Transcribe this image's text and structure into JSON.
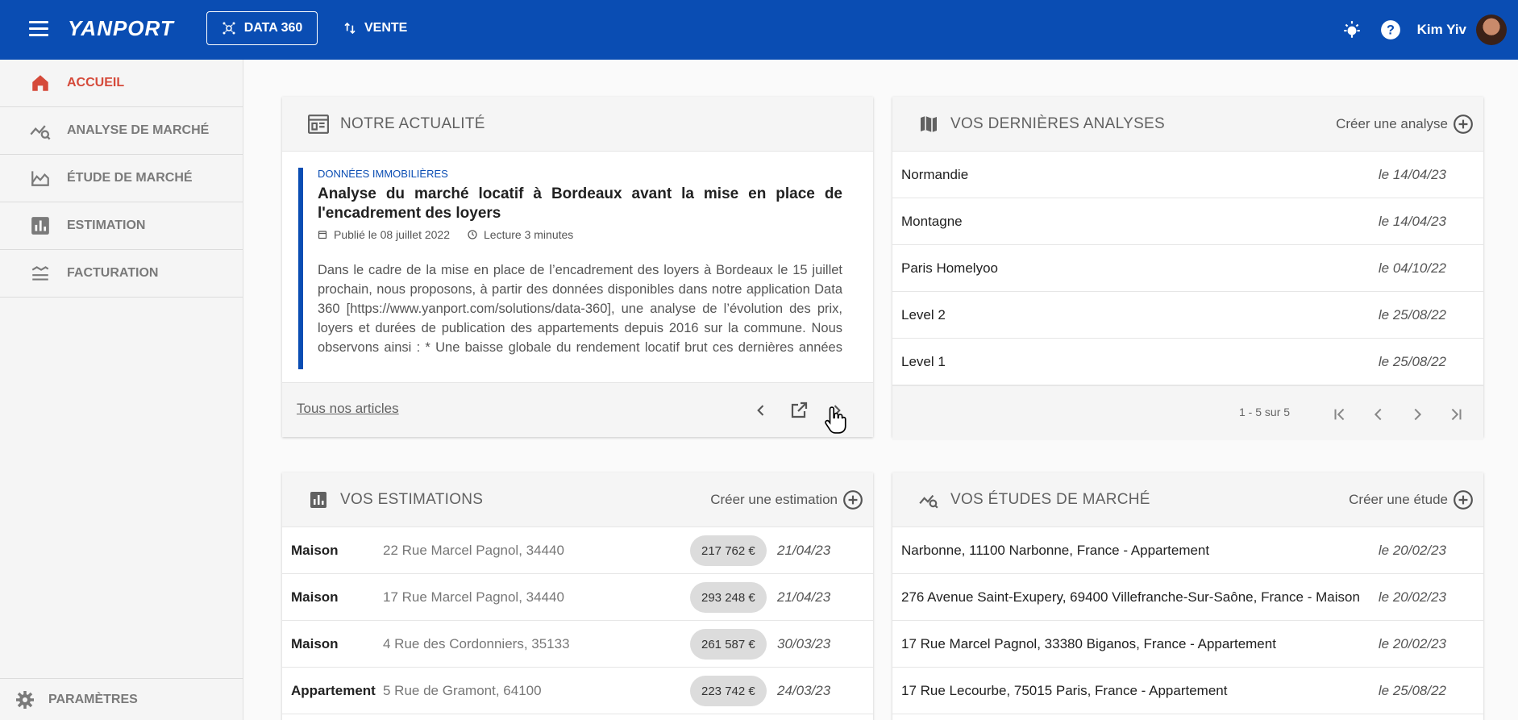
{
  "app": {
    "logo": "YANPORT",
    "data360_label": "DATA 360",
    "vente_label": "VENTE",
    "user_name": "Kim Yiv",
    "accent": "#0a4db3",
    "active_color": "#d54a3a"
  },
  "sidebar": {
    "items": [
      {
        "label": "ACCUEIL",
        "icon": "home-icon"
      },
      {
        "label": "ANALYSE DE MARCHÉ",
        "icon": "market-analysis-icon"
      },
      {
        "label": "ÉTUDE DE MARCHÉ",
        "icon": "market-study-icon"
      },
      {
        "label": "ESTIMATION",
        "icon": "bar-chart-icon"
      },
      {
        "label": "FACTURATION",
        "icon": "billing-icon"
      }
    ],
    "settings_label": "PARAMÈTRES"
  },
  "news": {
    "header": "NOTRE ACTUALITÉ",
    "category": "DONNÉES IMMOBILIÈRES",
    "title": "Analyse du marché locatif à Bordeaux avant la mise en place de l'encadrement des loyers",
    "published": "Publié le 08 juillet 2022",
    "reading": "Lecture 3 minutes",
    "text": "Dans le cadre de la mise en place de l’encadrement des loyers à Bordeaux le 15 juillet prochain, nous proposons, à partir des données disponibles dans notre application Data 360 [https://www.yanport.com/solutions/data-360], une analyse de l’évolution des prix, loyers et durées de publication des appartements depuis 2016 sur la commune. Nous observons ainsi : * Une baisse globale du rendement locatif brut ces dernières années due à une augmentation des prix plus rapide que celle des loyers",
    "all_link": "Tous nos articles"
  },
  "analyses": {
    "header": "VOS DERNIÈRES ANALYSES",
    "action": "Créer une analyse",
    "rows": [
      {
        "name": "Normandie",
        "date": "le 14/04/23"
      },
      {
        "name": "Montagne",
        "date": "le 14/04/23"
      },
      {
        "name": "Paris Homelyoo",
        "date": "le 04/10/22"
      },
      {
        "name": "Level 2",
        "date": "le 25/08/22"
      },
      {
        "name": "Level 1",
        "date": "le 25/08/22"
      }
    ],
    "pager_text": "1 - 5 sur 5"
  },
  "estimations": {
    "header": "VOS ESTIMATIONS",
    "action": "Créer une estimation",
    "rows": [
      {
        "type": "Maison",
        "address": "22 Rue Marcel Pagnol, 34440",
        "price": "217 762 €",
        "date": "21/04/23"
      },
      {
        "type": "Maison",
        "address": "17 Rue Marcel Pagnol, 34440",
        "price": "293 248 €",
        "date": "21/04/23"
      },
      {
        "type": "Maison",
        "address": "4 Rue des Cordonniers, 35133",
        "price": "261 587 €",
        "date": "30/03/23"
      },
      {
        "type": "Appartement",
        "address": "5 Rue de Gramont, 64100",
        "price": "223 742 €",
        "date": "24/03/23"
      }
    ]
  },
  "studies": {
    "header": "VOS ÉTUDES DE MARCHÉ",
    "action": "Créer une étude",
    "rows": [
      {
        "name": "Narbonne, 11100 Narbonne, France - Appartement",
        "date": "le 20/02/23"
      },
      {
        "name": "276 Avenue Saint-Exupery, 69400 Villefranche-Sur-Saône, France - Maison",
        "date": "le 20/02/23"
      },
      {
        "name": "17 Rue Marcel Pagnol, 33380 Biganos, France - Appartement",
        "date": "le 20/02/23"
      },
      {
        "name": "17 Rue Lecourbe, 75015 Paris, France - Appartement",
        "date": "le 25/08/22"
      }
    ]
  }
}
